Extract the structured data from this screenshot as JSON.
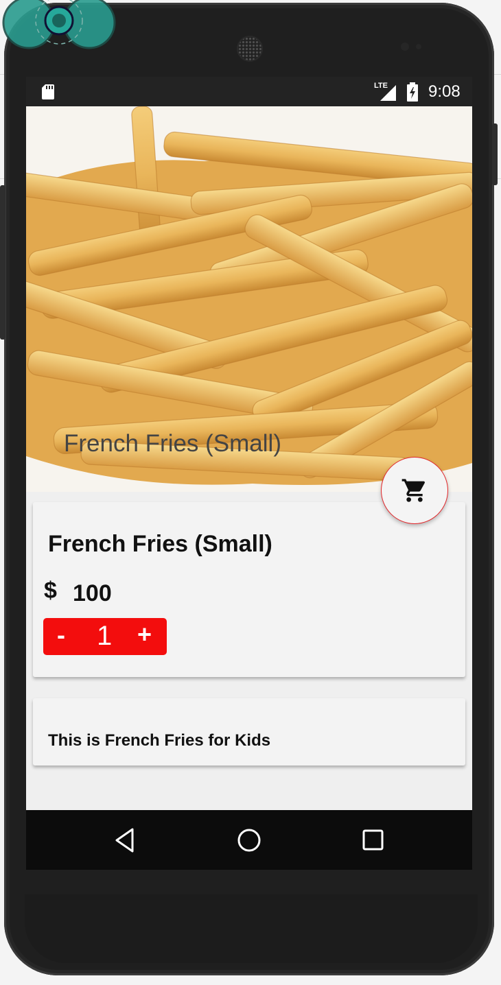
{
  "status_bar": {
    "network": "LTE",
    "time": "9:08"
  },
  "hero": {
    "title": "French Fries (Small)"
  },
  "product": {
    "name": "French Fries (Small)",
    "currency": "$",
    "price": "100",
    "quantity": "1",
    "decrement_label": "-",
    "increment_label": "+"
  },
  "description": {
    "text": "This is French Fries for Kids"
  },
  "colors": {
    "accent": "#f30d0d",
    "fab_border": "#e3262a",
    "card_bg": "#f3f3f3"
  },
  "icons": {
    "status_left": "sd-card-icon",
    "status_signal": "signal-icon",
    "status_battery": "battery-charging-icon",
    "fab": "shopping-cart-icon",
    "nav": [
      "back-icon",
      "home-icon",
      "recents-icon"
    ]
  }
}
